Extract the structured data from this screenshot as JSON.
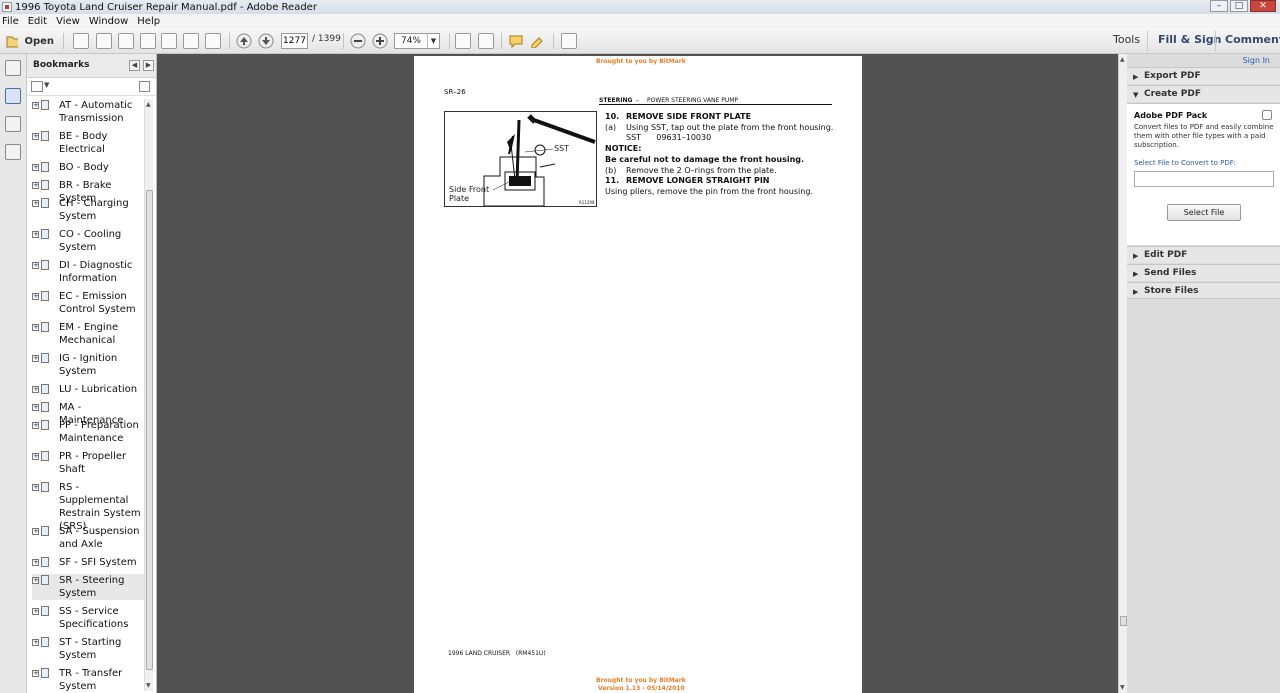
{
  "window": {
    "title": "1996 Toyota Land Cruiser Repair Manual.pdf - Adobe Reader",
    "buttons": [
      "–",
      "□",
      "✕"
    ]
  },
  "menu": [
    "File",
    "Edit",
    "View",
    "Window",
    "Help"
  ],
  "toolbar": {
    "open_label": "Open",
    "page_current": "1277",
    "page_total": "/ 1399",
    "zoom": "74%",
    "tools_label": "Tools",
    "fill_sign_label": "Fill & Sign",
    "comment_label": "Comment"
  },
  "bookmarks": {
    "title": "Bookmarks",
    "items": [
      {
        "lines": [
          "AT - Automatic",
          "Transmission"
        ]
      },
      {
        "lines": [
          "BE - Body",
          "Electrical"
        ]
      },
      {
        "lines": [
          "BO - Body"
        ]
      },
      {
        "lines": [
          "BR - Brake System"
        ]
      },
      {
        "lines": [
          "CH - Charging",
          "System"
        ]
      },
      {
        "lines": [
          "CO - Cooling",
          "System"
        ]
      },
      {
        "lines": [
          "DI - Diagnostic",
          "Information"
        ]
      },
      {
        "lines": [
          "EC - Emission",
          "Control System"
        ]
      },
      {
        "lines": [
          "EM - Engine",
          "Mechanical"
        ]
      },
      {
        "lines": [
          "IG - Ignition",
          "System"
        ]
      },
      {
        "lines": [
          "LU - Lubrication"
        ]
      },
      {
        "lines": [
          "MA - Maintenance"
        ]
      },
      {
        "lines": [
          "PP - Preparation",
          "Maintenance"
        ]
      },
      {
        "lines": [
          "PR - Propeller",
          "Shaft"
        ]
      },
      {
        "lines": [
          "RS - Supplemental",
          "Restrain System",
          "(SRS)"
        ]
      },
      {
        "lines": [
          "SA - Suspension",
          "and Axle"
        ]
      },
      {
        "lines": [
          "SF - SFI System"
        ]
      },
      {
        "lines": [
          "SR - Steering",
          "System"
        ],
        "selected": true
      },
      {
        "lines": [
          "SS - Service",
          "Specifications"
        ]
      },
      {
        "lines": [
          "ST - Starting",
          "System"
        ]
      },
      {
        "lines": [
          "TR - Transfer",
          "System"
        ]
      }
    ]
  },
  "document": {
    "watermark_top": "Brought to you by BitMark",
    "watermark_bottom_1": "Brought to you by BitMark",
    "watermark_bottom_2": "Version 1.13 - 05/14/2010",
    "page_code": "SR–26",
    "header_section": "STEERING",
    "header_dash": "–",
    "header_sub": "POWER STEERING VANE PUMP",
    "figure_labels": {
      "sst": "SST",
      "side_front": "Side Front",
      "plate": "Plate",
      "code": "R11298"
    },
    "lines": [
      {
        "num": "10.",
        "text": "REMOVE SIDE FRONT PLATE",
        "bold": true
      },
      {
        "num": "(a)",
        "text": "Using SST, tap out the plate from the front housing.",
        "bold": false
      },
      {
        "num": "",
        "text": "SST      09631–10030",
        "bold": false
      },
      {
        "num": "",
        "text": "NOTICE:",
        "bold": true
      },
      {
        "num": "",
        "text": "Be careful not to damage the front housing.",
        "bold": true
      },
      {
        "num": "(b)",
        "text": "Remove the 2 O–rings from the plate.",
        "bold": false
      },
      {
        "num": "11.",
        "text": "REMOVE LONGER STRAIGHT PIN",
        "bold": true
      },
      {
        "num": "",
        "text": "Using pliers, remove the pin from the front housing.",
        "bold": false
      }
    ],
    "footer": "1996 LAND CRUISER   (RM451U)"
  },
  "right_panel": {
    "sign_in": "Sign In",
    "export_pdf": "Export PDF",
    "create_pdf": "Create PDF",
    "pack_title": "Adobe PDF Pack",
    "pack_desc": "Convert files to PDF and easily combine them with other file types with a paid subscription.",
    "select_label": "Select File to Convert to PDF:",
    "select_button": "Select File",
    "edit_pdf": "Edit PDF",
    "send_files": "Send Files",
    "store_files": "Store Files"
  },
  "colors": {
    "doc_bg": "#525252",
    "watermark": "#e87d25",
    "link": "#2a5aa8"
  }
}
